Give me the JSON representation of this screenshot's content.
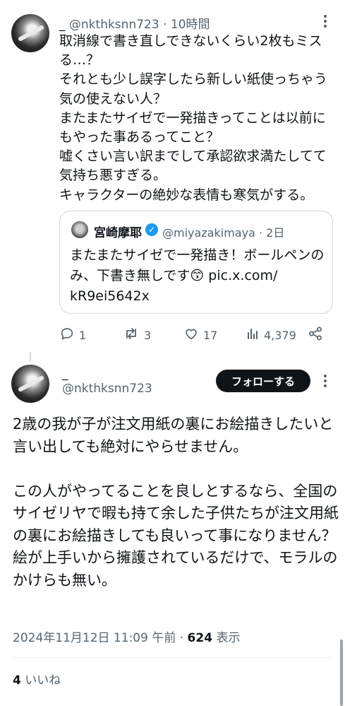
{
  "reply_tweet": {
    "name": "_",
    "handle": "@nkthksnn723",
    "time": "10時間",
    "body": "取消線で書き直しできないくらい2枚もミスる…？\nそれとも少し誤字したら新しい紙使っちゃう気の使えない人？\nまたまたサイゼで一発描きってことは以前にもやった事あるってこと？\n嘘くさい言い訳までして承認欲求満たしてて気持ち悪すぎる。\nキャラクターの絶妙な表情も寒気がする。",
    "quoted": {
      "name": "宮崎摩耶",
      "handle": "@miyazakimaya",
      "time": "2日",
      "body": "またまたサイゼで一発描き！ボールペンのみ、下書き無しです😙 pic.x.com/\nkR9ei5642x"
    },
    "actions": {
      "replies": "1",
      "reposts": "3",
      "likes": "17",
      "views": "4,379"
    }
  },
  "main_tweet": {
    "name": "_",
    "handle": "@nkthksnn723",
    "follow_label": "フォローする",
    "body": "2歳の我が子が注文用紙の裏にお絵描きしたいと言い出しても絶対にやらせません。\n\nこの人がやってることを良しとするなら、全国のサイゼリヤで暇も持て余した子供たちが注文用紙の裏にお絵描きしても良いって事になりません？\n絵が上手いから擁護されているだけで、モラルのかけらも無い。",
    "timestamp": "2024年11月12日 11:09 午前",
    "separator": "·",
    "views_count": "624",
    "views_label": "表示",
    "likes_count": "4",
    "likes_label": "いいね"
  },
  "colors": {
    "text": "#0f1419",
    "muted": "#536471",
    "border": "#cfd9de",
    "verified": "#1d9bf0",
    "button_bg": "#0f1419"
  }
}
